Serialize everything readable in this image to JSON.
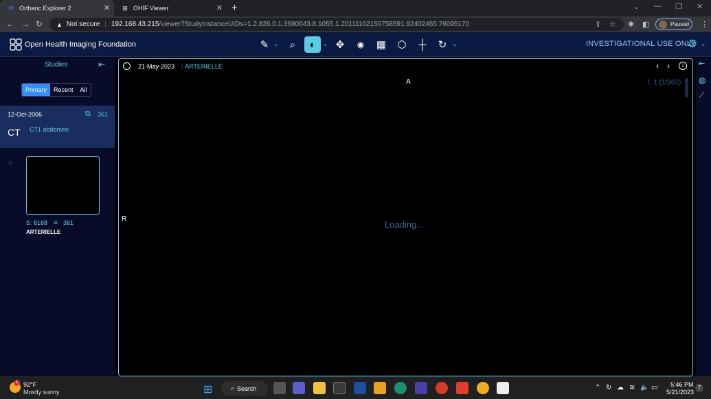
{
  "browser": {
    "tabs": [
      {
        "label": "Orthanc Explorer 2",
        "icon": "orthanc-icon",
        "active": true
      },
      {
        "label": "OHIF Viewer",
        "icon": "ohif-icon",
        "active": false
      }
    ],
    "new_tab": "+",
    "address": {
      "security": "Not secure",
      "host": "192.168.43.215",
      "path": "/viewer?StudyInstanceUIDs=1.2.826.0.1.3680043.8.1055.1.20111102150758591.92402465.76095170"
    },
    "profile_label": "Paused"
  },
  "header": {
    "brand": "Open Health Imaging Foundation",
    "notice": "INVESTIGATIONAL USE ONLY",
    "tools": [
      "pencil-icon",
      "magnify-icon",
      "contrast-icon",
      "move-icon",
      "camera-icon",
      "layout-icon",
      "cube-icon",
      "crosshair-icon",
      "rotate-icon"
    ]
  },
  "sidebar": {
    "title": "Studies",
    "tabs": [
      "Primary",
      "Recent",
      "All"
    ],
    "active_tab": "Primary",
    "study": {
      "date": "12-Oct-2006",
      "count": "361",
      "modality": "CT",
      "description": "CT1 abdomen"
    },
    "series": {
      "series_num": "S: 6168",
      "image_count": "361",
      "name": "ARTERIELLE"
    }
  },
  "viewport": {
    "date": "21-May-2023",
    "series_name": "ARTERIELLE",
    "orientation_top": "A",
    "orientation_left": "R",
    "image_index": "I: 1 (1/361)",
    "loading": "Loading..."
  },
  "taskbar": {
    "weather_temp": "92°F",
    "weather_desc": "Mostly sunny",
    "search_label": "Search",
    "time": "5:46 PM",
    "date": "5/21/2023",
    "notif_count": "7"
  },
  "colors": {
    "accent": "#5acce6",
    "header_bg": "#0b1a42",
    "sidebar_bg": "#090c29",
    "primary_btn": "#348cfd"
  }
}
